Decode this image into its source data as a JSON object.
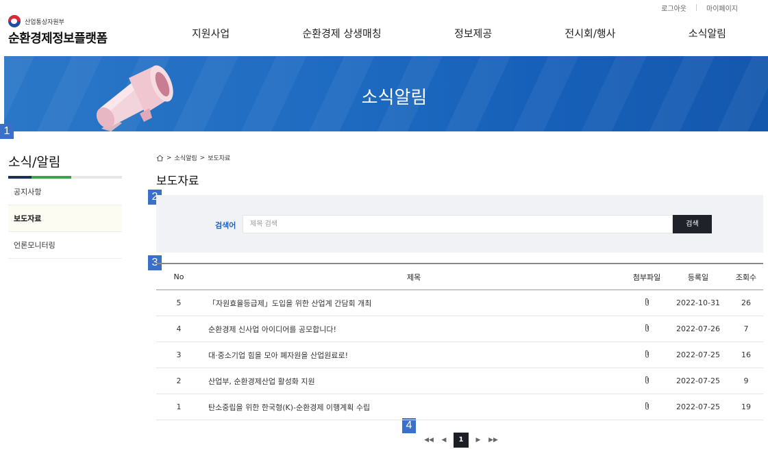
{
  "util": {
    "logout": "로그아웃",
    "mypage": "마이페이지"
  },
  "logo": {
    "ministry": "산업통상자원부",
    "title": "순환경제정보플랫폼"
  },
  "gnb": [
    "지원사업",
    "순환경제 상생매칭",
    "정보제공",
    "전시회/행사",
    "소식알림"
  ],
  "banner": {
    "title": "소식알림"
  },
  "badges": [
    "1",
    "2",
    "3",
    "4"
  ],
  "sidebar": {
    "title": "소식/알림",
    "items": [
      "공지사항",
      "보도자료",
      "언론모니터링"
    ],
    "bar_colors": [
      "#1f2f5c",
      "#3aa54a",
      "#e6e6e6"
    ]
  },
  "breadcrumb": {
    "home_icon": "home-icon",
    "items": [
      "소식알림",
      "보도자료"
    ],
    "sep": ">"
  },
  "page_title": "보도자료",
  "search": {
    "label": "검색어",
    "placeholder": "제목 검색",
    "button": "검색"
  },
  "table": {
    "headers": {
      "no": "No",
      "title": "제목",
      "file": "첨부파일",
      "date": "등록일",
      "views": "조회수"
    },
    "rows": [
      {
        "no": "5",
        "title": "「자원효율등급제」도입을 위한 산업계 간담회 개최",
        "date": "2022-10-31",
        "views": "26"
      },
      {
        "no": "4",
        "title": "순환경제 신사업 아이디어를 공모합니다!",
        "date": "2022-07-26",
        "views": "7"
      },
      {
        "no": "3",
        "title": "대·중소기업 힘을 모아 폐자원을 산업원료로!",
        "date": "2022-07-25",
        "views": "16"
      },
      {
        "no": "2",
        "title": "산업부, 순환경제산업 활성화 지원",
        "date": "2022-07-25",
        "views": "9"
      },
      {
        "no": "1",
        "title": "탄소중립을 위한 한국형(K)-순환경제 이행계획 수립",
        "date": "2022-07-25",
        "views": "19"
      }
    ]
  },
  "pager": {
    "first": "◀◀",
    "prev": "◀",
    "current": "1",
    "next": "▶",
    "last": "▶▶"
  }
}
